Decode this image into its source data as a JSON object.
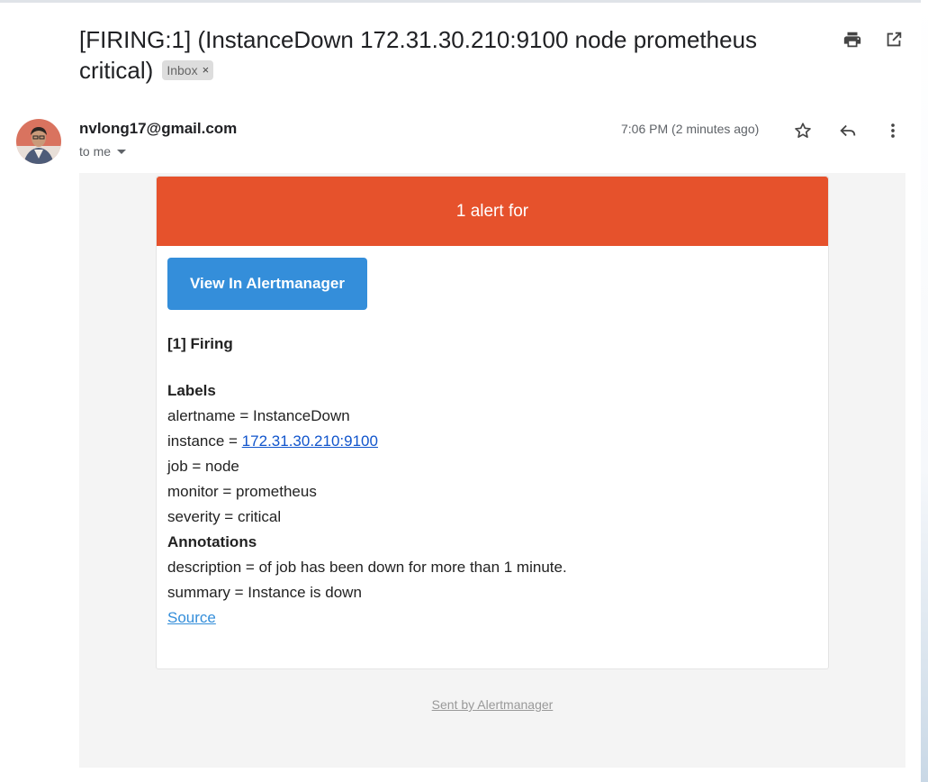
{
  "email": {
    "subject": "[FIRING:1] (InstanceDown 172.31.30.210:9100 node prometheus critical)",
    "label_chip": "Inbox",
    "label_remove": "×",
    "sender": "nvlong17@gmail.com",
    "recipient": "to me",
    "time": "7:06 PM (2 minutes ago)"
  },
  "icons": {
    "print": "print-icon",
    "open_new": "open-in-new-window-icon",
    "star": "star-icon",
    "reply": "reply-icon",
    "more": "more-vert-icon",
    "dropdown": "chevron-down-icon"
  },
  "alert": {
    "banner": "1 alert for",
    "button": "View In Alertmanager",
    "firing": "[1] Firing",
    "labels_heading": "Labels",
    "labels": {
      "alertname": "alertname = InstanceDown",
      "instance_prefix": "instance = ",
      "instance_link": "172.31.30.210:9100",
      "job": "job = node",
      "monitor": "monitor = prometheus",
      "severity": "severity = critical"
    },
    "annotations_heading": "Annotations",
    "annotations": {
      "description": "description = of job has been down for more than 1 minute.",
      "summary": "summary = Instance is down"
    },
    "source": "Source",
    "footer": "Sent by Alertmanager"
  },
  "colors": {
    "banner": "#e6522c",
    "button": "#348eda",
    "link": "#1155cc"
  }
}
